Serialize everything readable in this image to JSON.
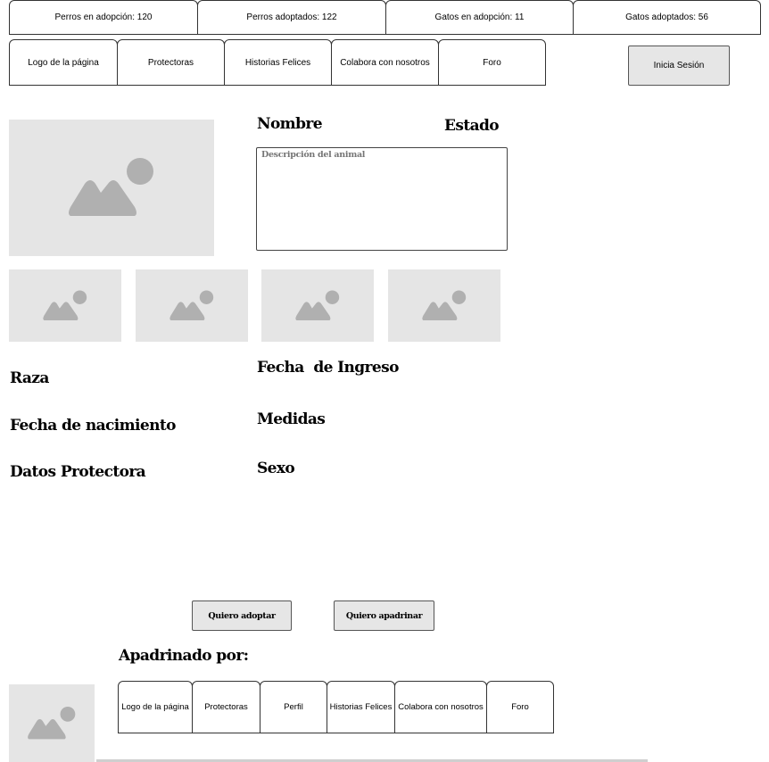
{
  "stats": [
    {
      "label": "Perros en adopción: 120"
    },
    {
      "label": "Perros adoptados: 122"
    },
    {
      "label": "Gatos en adopción: 11"
    },
    {
      "label": "Gatos adoptados: 56"
    }
  ],
  "nav": [
    {
      "label": "Logo de la página"
    },
    {
      "label": "Protectoras"
    },
    {
      "label": "Historias Felices"
    },
    {
      "label": "Colabora con nosotros"
    },
    {
      "label": "Foro"
    }
  ],
  "login": {
    "label": "Inicia Sesión"
  },
  "animal": {
    "name_label": "Nombre",
    "status_label": "Estado",
    "description_placeholder": "Descripción del animal",
    "breed_label": "Raza",
    "birth_label": "Fecha de nacimiento",
    "shelter_label": "Datos Protectora",
    "intake_label": "Fecha  de Ingreso",
    "measures_label": "Medidas",
    "sex_label": "Sexo"
  },
  "actions": {
    "adopt_label": "Quiero adoptar",
    "sponsor_label": "Quiero apadrinar"
  },
  "sponsored": {
    "title": "Apadrinado por:"
  },
  "footer_nav": [
    {
      "label": "Logo de la página"
    },
    {
      "label": "Protectoras"
    },
    {
      "label": "Perfil"
    },
    {
      "label": "Historias Felices"
    },
    {
      "label": "Colabora con nosotros"
    },
    {
      "label": "Foro"
    }
  ],
  "icons": {
    "image_placeholder": "image-placeholder-icon"
  }
}
